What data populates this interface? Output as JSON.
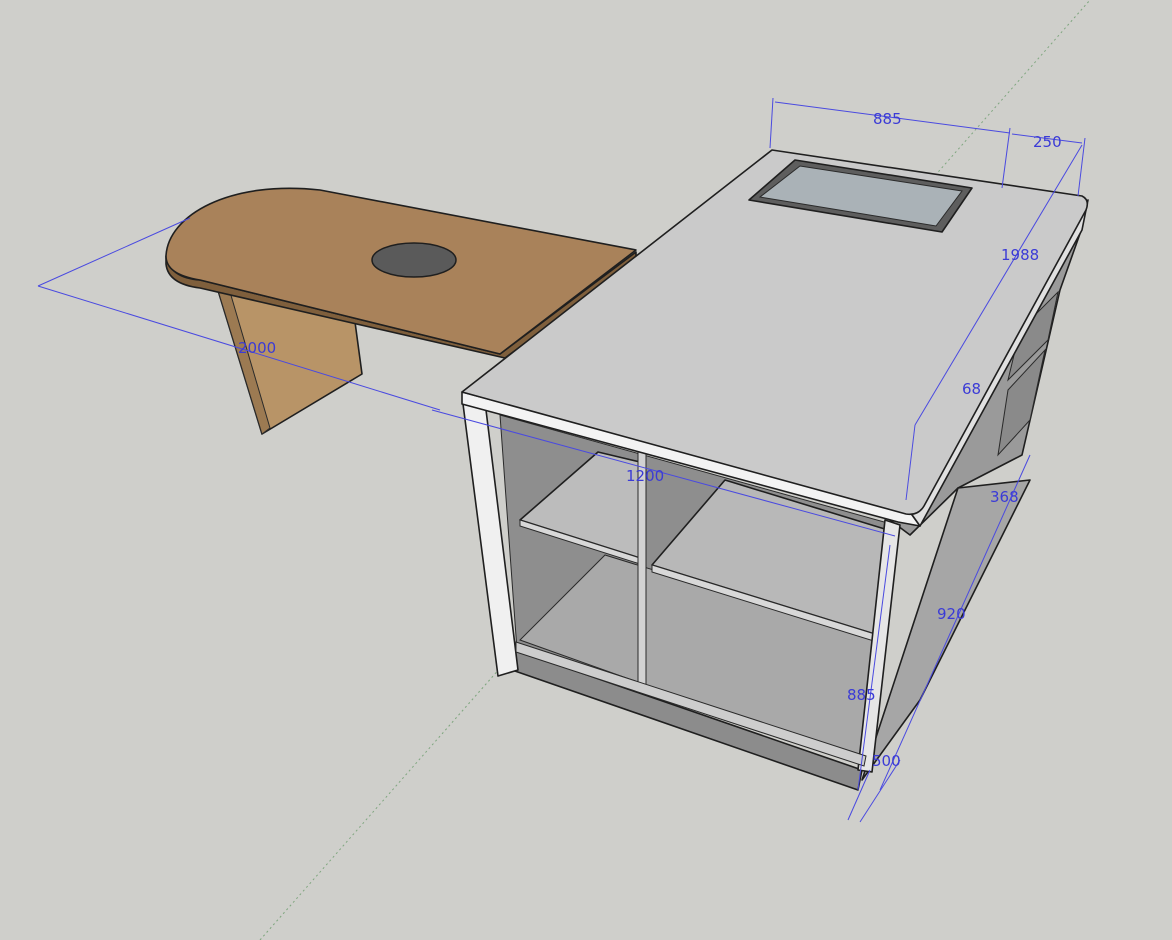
{
  "colors": {
    "background": "#cfcfcb",
    "wood_top": "#a9825a",
    "wood_leg": "#b89467",
    "counter_top": "#cacaca",
    "counter_edge": "#f2f2f2",
    "interior_dark": "#8e8e8e",
    "interior_mid": "#a8a8a8",
    "sink": "#aab2b7",
    "dimension": "#3b3bd6"
  },
  "dimensions": {
    "d885_top": "885",
    "d250": "250",
    "d1988": "1988",
    "d2000": "2000",
    "d68": "68",
    "d1200": "1200",
    "d368": "368",
    "d920": "920",
    "d885_side": "885",
    "d500": "500"
  }
}
